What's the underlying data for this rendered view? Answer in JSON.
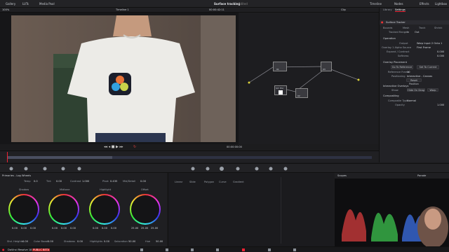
{
  "topbar": {
    "items": [
      "Gallery",
      "LUTs",
      "Media Pool"
    ],
    "title": "Surface tracking",
    "title_sub": "Edited",
    "right": [
      "Timeline",
      "Nodes",
      "Effects",
      "Lightbox"
    ]
  },
  "row2": {
    "zoom": "100%",
    "timeline": "Timeline 1",
    "timecode": "00:00:42:11",
    "clip": "Clip"
  },
  "viewer": {
    "timecode": "00:00:00:00"
  },
  "nodes": [
    {
      "label": "01"
    },
    {
      "label": "Srf. Trkr"
    },
    {
      "label": "02"
    },
    {
      "label": "03"
    }
  ],
  "inspector": {
    "tabs": [
      "Library",
      "Settings"
    ],
    "header": "Surface Tracker",
    "subtabs": [
      "Bounds",
      "Mesh",
      "Track",
      "Shrink"
    ],
    "tracked_range_label": "Tracked Range",
    "tracked_range_in": "In",
    "tracked_range_out": "Out",
    "sections": [
      "Operation",
      "Overlay Placement",
      "Interactive Overlays",
      "Compositing"
    ],
    "fields": [
      {
        "label": "Output",
        "value": "Warp Input 2 Onto 1"
      },
      {
        "label": "Overlay 1 Alpha Source",
        "value": "First Frame"
      },
      {
        "label": "Expand / Contract",
        "value": "0.000"
      },
      {
        "label": "Softness",
        "value": "0.000"
      },
      {
        "label": "Reference Frame",
        "value": "10"
      },
      {
        "label": "Positioning",
        "value": "Interactive - Canvas"
      },
      {
        "label": "Composite Type",
        "value": "Normal"
      },
      {
        "label": "Opacity",
        "value": "1.000"
      }
    ],
    "buttons": [
      "Go To Reference",
      "Set To Current",
      "Reset Position",
      "Hide On Drag",
      "Warp"
    ],
    "show_label": "Show"
  },
  "primaries": {
    "title": "Primaries - Log Wheels",
    "temp_label": "Temp",
    "temp": "0.0",
    "tint_label": "Tint",
    "tint": "0.00",
    "contrast_label": "Contrast",
    "contrast": "1.000",
    "pivot_label": "Pivot",
    "pivot": "0.435",
    "mid_label": "Mid/Detail",
    "mid": "0.00",
    "wheels": [
      {
        "name": "Shadow",
        "vals": [
          "0.00",
          "0.00",
          "0.00"
        ]
      },
      {
        "name": "Midtone",
        "vals": [
          "0.00",
          "0.00",
          "0.00"
        ]
      },
      {
        "name": "Highlight",
        "vals": [
          "0.00",
          "0.00",
          "0.00"
        ]
      },
      {
        "name": "Offset",
        "vals": [
          "25.00",
          "25.00",
          "25.00"
        ]
      }
    ],
    "bottom_labels": [
      "Shd. Heights",
      "Color Boost",
      "Shadows",
      "Highlights",
      "Saturation",
      "Hue"
    ],
    "bottom_vals": [
      "0.00",
      "0.00",
      "0.00",
      "0.00",
      "50.00",
      "50.00"
    ]
  },
  "curves": {
    "tabs": [
      "Linear",
      "Slide",
      "Polygon",
      "Curve",
      "Gradient"
    ]
  },
  "scopes": {
    "title": "Scopes",
    "mode": "Parade"
  },
  "bottombar": {
    "app": "DaVinci Resolve 18",
    "badge": "PUBLIC BETA"
  }
}
